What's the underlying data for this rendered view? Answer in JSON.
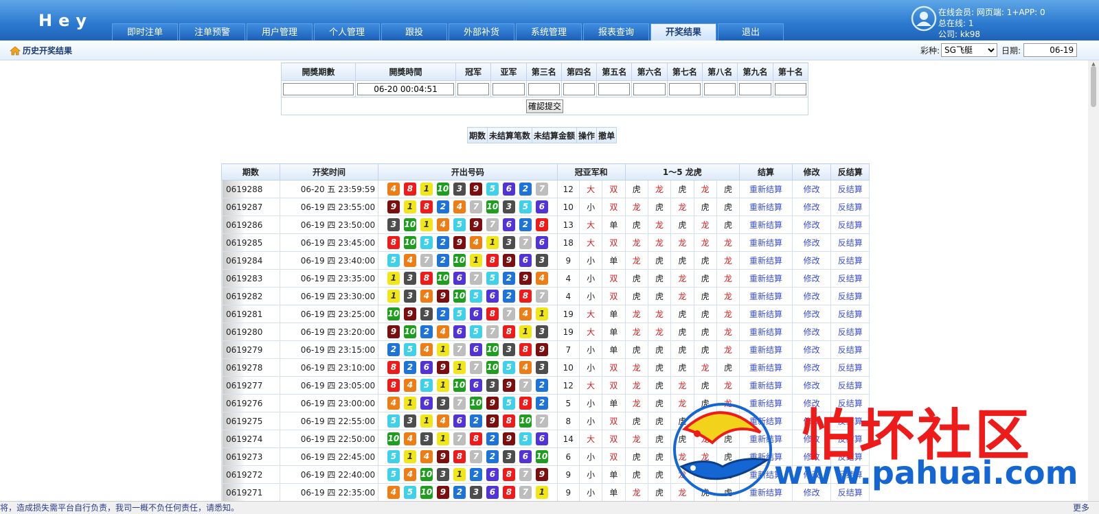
{
  "header": {
    "logo": "Hey",
    "tabs": [
      "即时注单",
      "注单预警",
      "用户管理",
      "个人管理",
      "跟投",
      "外部补货",
      "系统管理",
      "报表查询",
      "开奖结果",
      "退出"
    ],
    "user_line1": "在线会员: 网页端: 1+APP: 0",
    "user_line2": "总在线: 1",
    "user_line3": "公司: kk98"
  },
  "subbar": {
    "title": "历史开奖结果",
    "lottery_label": "彩种:",
    "lottery_value": "SG飞艇",
    "date_label": "日期:",
    "date_value": "06-19"
  },
  "form": {
    "headers": [
      "開獎期數",
      "開獎時間",
      "冠军",
      "亚军",
      "第三名",
      "第四名",
      "第五名",
      "第六名",
      "第七名",
      "第八名",
      "第九名",
      "第十名"
    ],
    "time_value": "06-20 00:04:51",
    "submit_label": "確認提交"
  },
  "stats": {
    "headers": [
      "期数",
      "未结算笔数",
      "未结算金额",
      "操作",
      "撤单"
    ]
  },
  "results": {
    "headers": [
      "期数",
      "开奖时间",
      "开出号码",
      "冠亚军和",
      "1～5 龙虎",
      "结算",
      "修改",
      "反结算"
    ],
    "rows": [
      {
        "period": "0619288",
        "time": "06-20 五 23:59:59",
        "nums": [
          4,
          8,
          1,
          10,
          3,
          9,
          5,
          6,
          2,
          7
        ],
        "sum": "12",
        "bs": "大",
        "oe": "双",
        "lh": [
          "虎",
          "龙",
          "虎",
          "龙",
          "虎"
        ],
        "settle": "重新结算",
        "edit": "修改",
        "reverse": "反结算"
      },
      {
        "period": "0619287",
        "time": "06-19 四 23:55:00",
        "nums": [
          9,
          1,
          8,
          2,
          4,
          7,
          10,
          3,
          5,
          6
        ],
        "sum": "10",
        "bs": "小",
        "oe": "双",
        "lh": [
          "龙",
          "虎",
          "龙",
          "虎",
          "虎"
        ],
        "settle": "重新结算",
        "edit": "修改",
        "reverse": "反结算"
      },
      {
        "period": "0619286",
        "time": "06-19 四 23:50:00",
        "nums": [
          3,
          10,
          1,
          4,
          5,
          9,
          7,
          6,
          2,
          8
        ],
        "sum": "13",
        "bs": "大",
        "oe": "单",
        "lh": [
          "虎",
          "龙",
          "虎",
          "龙",
          "虎"
        ],
        "settle": "重新结算",
        "edit": "修改",
        "reverse": "反结算"
      },
      {
        "period": "0619285",
        "time": "06-19 四 23:45:00",
        "nums": [
          8,
          10,
          5,
          2,
          9,
          4,
          1,
          3,
          7,
          6
        ],
        "sum": "18",
        "bs": "大",
        "oe": "双",
        "lh": [
          "龙",
          "龙",
          "龙",
          "龙",
          "龙"
        ],
        "settle": "重新结算",
        "edit": "修改",
        "reverse": "反结算"
      },
      {
        "period": "0619284",
        "time": "06-19 四 23:40:00",
        "nums": [
          5,
          4,
          7,
          2,
          10,
          1,
          8,
          9,
          6,
          3
        ],
        "sum": "9",
        "bs": "小",
        "oe": "单",
        "lh": [
          "龙",
          "虎",
          "虎",
          "虎",
          "龙"
        ],
        "settle": "重新结算",
        "edit": "修改",
        "reverse": "反结算"
      },
      {
        "period": "0619283",
        "time": "06-19 四 23:35:00",
        "nums": [
          1,
          3,
          8,
          10,
          6,
          7,
          5,
          2,
          9,
          4
        ],
        "sum": "4",
        "bs": "小",
        "oe": "双",
        "lh": [
          "虎",
          "虎",
          "龙",
          "虎",
          "龙"
        ],
        "settle": "重新结算",
        "edit": "修改",
        "reverse": "反结算"
      },
      {
        "period": "0619282",
        "time": "06-19 四 23:30:00",
        "nums": [
          1,
          3,
          4,
          9,
          10,
          5,
          6,
          2,
          8,
          7
        ],
        "sum": "4",
        "bs": "小",
        "oe": "双",
        "lh": [
          "虎",
          "虎",
          "龙",
          "虎",
          "龙"
        ],
        "settle": "重新结算",
        "edit": "修改",
        "reverse": "反结算"
      },
      {
        "period": "0619281",
        "time": "06-19 四 23:25:00",
        "nums": [
          10,
          9,
          3,
          2,
          5,
          6,
          8,
          7,
          4,
          1
        ],
        "sum": "19",
        "bs": "大",
        "oe": "单",
        "lh": [
          "龙",
          "龙",
          "虎",
          "虎",
          "龙"
        ],
        "settle": "重新结算",
        "edit": "修改",
        "reverse": "反结算"
      },
      {
        "period": "0619280",
        "time": "06-19 四 23:20:00",
        "nums": [
          9,
          10,
          2,
          4,
          6,
          5,
          7,
          8,
          1,
          3
        ],
        "sum": "19",
        "bs": "大",
        "oe": "单",
        "lh": [
          "龙",
          "龙",
          "虎",
          "虎",
          "龙"
        ],
        "settle": "重新结算",
        "edit": "修改",
        "reverse": "反结算"
      },
      {
        "period": "0619279",
        "time": "06-19 四 23:15:00",
        "nums": [
          2,
          5,
          4,
          1,
          7,
          6,
          10,
          3,
          8,
          9
        ],
        "sum": "7",
        "bs": "小",
        "oe": "单",
        "lh": [
          "虎",
          "虎",
          "虎",
          "虎",
          "龙"
        ],
        "settle": "重新结算",
        "edit": "修改",
        "reverse": "反结算"
      },
      {
        "period": "0619278",
        "time": "06-19 四 23:10:00",
        "nums": [
          8,
          2,
          6,
          9,
          1,
          7,
          10,
          5,
          4,
          3
        ],
        "sum": "10",
        "bs": "小",
        "oe": "双",
        "lh": [
          "龙",
          "虎",
          "虎",
          "龙",
          "虎"
        ],
        "settle": "重新结算",
        "edit": "修改",
        "reverse": "反结算"
      },
      {
        "period": "0619277",
        "time": "06-19 四 23:05:00",
        "nums": [
          8,
          4,
          5,
          1,
          10,
          6,
          3,
          9,
          7,
          2
        ],
        "sum": "12",
        "bs": "大",
        "oe": "双",
        "lh": [
          "龙",
          "虎",
          "龙",
          "虎",
          "龙"
        ],
        "settle": "重新结算",
        "edit": "修改",
        "reverse": "反结算"
      },
      {
        "period": "0619276",
        "time": "06-19 四 23:00:00",
        "nums": [
          4,
          1,
          6,
          3,
          7,
          10,
          9,
          5,
          8,
          2
        ],
        "sum": "5",
        "bs": "小",
        "oe": "单",
        "lh": [
          "龙",
          "虎",
          "龙",
          "虎",
          "龙"
        ],
        "settle": "重新结算",
        "edit": "修改",
        "reverse": "反结算"
      },
      {
        "period": "0619275",
        "time": "06-19 四 22:55:00",
        "nums": [
          5,
          3,
          1,
          4,
          6,
          2,
          9,
          8,
          10,
          7
        ],
        "sum": "8",
        "bs": "小",
        "oe": "双",
        "lh": [
          "虎",
          "虎",
          "虎",
          "龙",
          "龙"
        ],
        "settle": "重新结算",
        "edit": "修改",
        "reverse": "反结算"
      },
      {
        "period": "0619274",
        "time": "06-19 四 22:50:00",
        "nums": [
          10,
          4,
          3,
          1,
          7,
          8,
          2,
          9,
          5,
          6
        ],
        "sum": "14",
        "bs": "大",
        "oe": "双",
        "lh": [
          "龙",
          "虎",
          "虎",
          "龙",
          "虎"
        ],
        "settle": "重新结算",
        "edit": "修改",
        "reverse": "反结算"
      },
      {
        "period": "0619273",
        "time": "06-19 四 22:45:00",
        "nums": [
          5,
          1,
          4,
          9,
          8,
          7,
          2,
          3,
          6,
          10
        ],
        "sum": "6",
        "bs": "小",
        "oe": "双",
        "lh": [
          "虎",
          "虎",
          "龙",
          "龙",
          "虎"
        ],
        "settle": "重新结算",
        "edit": "修改",
        "reverse": "反结算"
      },
      {
        "period": "0619272",
        "time": "06-19 四 22:40:00",
        "nums": [
          5,
          4,
          10,
          3,
          1,
          2,
          6,
          8,
          7,
          9
        ],
        "sum": "9",
        "bs": "小",
        "oe": "单",
        "lh": [
          "虎",
          "虎",
          "龙",
          "虎",
          "虎"
        ],
        "settle": "重新结算",
        "edit": "修改",
        "reverse": "反结算"
      },
      {
        "period": "0619271",
        "time": "06-19 四 22:35:00",
        "nums": [
          4,
          5,
          10,
          9,
          2,
          3,
          6,
          8,
          7,
          1
        ],
        "sum": "9",
        "bs": "小",
        "oe": "单",
        "lh": [
          "龙",
          "虎",
          "龙",
          "虎",
          "虎"
        ],
        "settle": "重新结算",
        "edit": "修改",
        "reverse": "反结算"
      }
    ]
  },
  "footer": {
    "message": "将，造成损失需平台自行负责，我司一概不负任何责任，请悉知。",
    "more": "更多"
  },
  "watermark": {
    "text_cn": "怕坏社区",
    "url": "www.pahuai.com"
  },
  "colors": {
    "header_blue": "#2b79cf",
    "ball_1": "#f0e619",
    "ball_2": "#1e73d8",
    "ball_3": "#4d4d4d",
    "ball_4": "#ef7d15",
    "ball_5": "#3ed1e9",
    "ball_6": "#5133d6",
    "ball_7": "#bdbdbd",
    "ball_8": "#ef1a1a",
    "ball_9": "#7b0f0f",
    "ball_10": "#1e9d1e",
    "dragon_red": "#d12020",
    "link_blue": "#3b4fd4"
  },
  "icons": {
    "home": "home-icon",
    "user": "user-avatar-icon"
  }
}
